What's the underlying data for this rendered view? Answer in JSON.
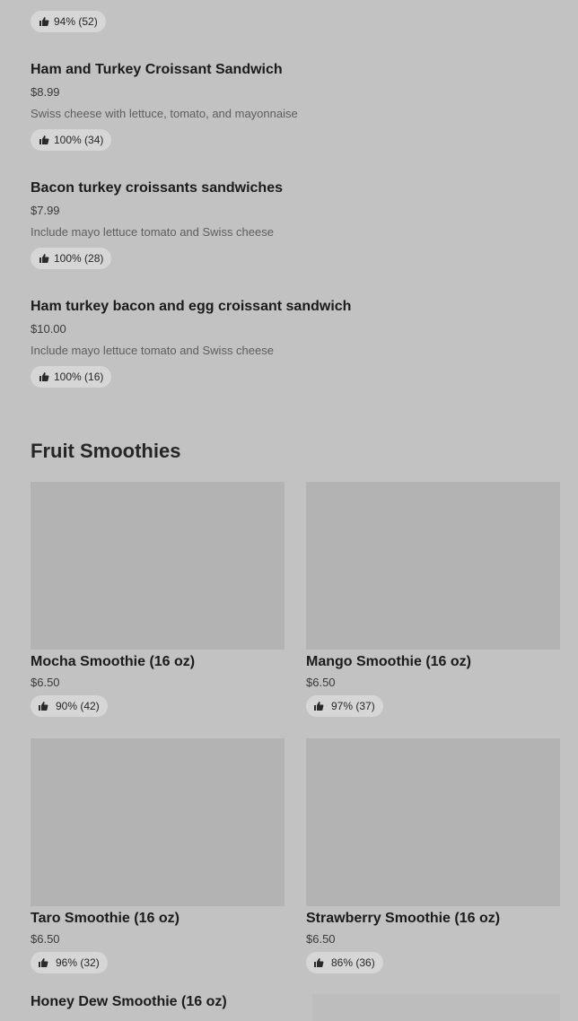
{
  "top_item": {
    "rating": "94% (52)"
  },
  "list_items": [
    {
      "title": "Ham and Turkey Croissant Sandwich",
      "price": "$8.99",
      "desc": "Swiss cheese with lettuce, tomato, and mayonnaise",
      "rating": "100% (34)"
    },
    {
      "title": "Bacon turkey croissants sandwiches",
      "price": "$7.99",
      "desc": "Include mayo lettuce tomato and Swiss cheese",
      "rating": "100% (28)"
    },
    {
      "title": "Ham turkey bacon and egg croissant sandwich",
      "price": "$10.00",
      "desc": "Include mayo lettuce tomato and Swiss cheese",
      "rating": "100% (16)"
    }
  ],
  "section": {
    "title": "Fruit Smoothies"
  },
  "cards": [
    {
      "title": "Mocha Smoothie (16 oz)",
      "price": "$6.50",
      "rating": "90% (42)"
    },
    {
      "title": "Mango Smoothie (16 oz)",
      "price": "$6.50",
      "rating": "97% (37)"
    },
    {
      "title": "Taro Smoothie (16 oz)",
      "price": "$6.50",
      "rating": "96% (32)"
    },
    {
      "title": "Strawberry Smoothie (16 oz)",
      "price": "$6.50",
      "rating": "86% (36)"
    },
    {
      "title": "Honey Dew Smoothie (16 oz)"
    }
  ],
  "icons": {
    "rating": "thumbs-up-icon"
  },
  "colors": {
    "background": "#c2c2c2",
    "badge": "#d6d6d6",
    "image_placeholder": "#b3b3b3"
  }
}
